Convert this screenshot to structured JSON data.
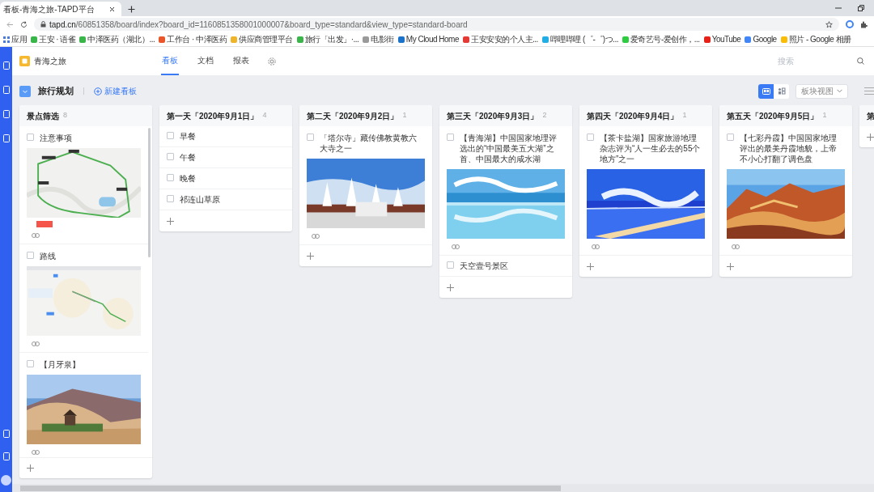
{
  "browser": {
    "tab_title": "看板-青海之旅-TAPD平台",
    "url_host": "tapd.cn",
    "url_path": "/60851358/board/index?board_id=1160851358001000007&board_type=standard&view_type=standard-board",
    "bookmarks": [
      {
        "label": "应用",
        "color": "#4a7bd8"
      },
      {
        "label": "王安 · 语雀",
        "color": "#39b54a"
      },
      {
        "label": "中泽医药（湖北）...",
        "color": "#39b54a"
      },
      {
        "label": "工作台 · 中泽医药",
        "color": "#e8562a"
      },
      {
        "label": "供应商管理平台",
        "color": "#f0b429"
      },
      {
        "label": "旅行「出发」·...",
        "color": "#39b54a"
      },
      {
        "label": "电影街",
        "color": "#9a9a9a"
      },
      {
        "label": "My Cloud Home",
        "color": "#1a73c8"
      },
      {
        "label": "王安安安的个人主...",
        "color": "#e53935"
      },
      {
        "label": "哔哩哔哩 (゜-゜)つ...",
        "color": "#23ade5"
      },
      {
        "label": "爱奇艺号-爱创作，...",
        "color": "#2ecc40"
      },
      {
        "label": "YouTube",
        "color": "#e62117"
      },
      {
        "label": "Google",
        "color": "#4285f4"
      },
      {
        "label": "照片 - Google 相册",
        "color": "#fbbc05"
      }
    ]
  },
  "app": {
    "project": "青海之旅",
    "nav_tabs": [
      {
        "label": "看板",
        "selected": true
      },
      {
        "label": "文档",
        "selected": false
      },
      {
        "label": "报表",
        "selected": false
      }
    ],
    "search": {
      "placeholder": "搜索"
    }
  },
  "toolbar": {
    "board_name": "旅行规划",
    "new_board": "新建看板",
    "view_toggle": [
      {
        "selected": true
      },
      {
        "selected": false
      }
    ],
    "view_dropdown": "板块视图"
  },
  "columns": [
    {
      "title": "景点筛选",
      "count": "8",
      "cards": [
        {
          "kind": "picture",
          "title": "注意事项",
          "checked": false,
          "label": {
            "color": "#f5544a"
          }
        },
        {
          "kind": "picture",
          "title": "路线",
          "checked": false
        },
        {
          "kind": "picture",
          "title": "【月牙泉】",
          "checked": false
        }
      ]
    },
    {
      "title": "第一天「2020年9月1日」",
      "count": "4",
      "cards": [
        {
          "kind": "task",
          "title": "早餐",
          "checked": false
        },
        {
          "kind": "task",
          "title": "午餐",
          "checked": false
        },
        {
          "kind": "task",
          "title": "晚餐",
          "checked": false
        },
        {
          "kind": "task",
          "title": "祁连山草原",
          "checked": false
        }
      ]
    },
    {
      "title": "第二天「2020年9月2日」",
      "count": "1",
      "cards": [
        {
          "kind": "picture",
          "title": "「塔尔寺」藏传佛教黄教六大寺之一",
          "checked": false
        }
      ]
    },
    {
      "title": "第三天「2020年9月3日」",
      "count": "2",
      "cards": [
        {
          "kind": "picture",
          "title": "【青海湖】中国国家地理评选出的“中国最美五大湖”之首、中国最大的咸水湖",
          "checked": false
        },
        {
          "kind": "task",
          "title": "天空壹号景区",
          "checked": false
        }
      ]
    },
    {
      "title": "第四天「2020年9月4日」",
      "count": "1",
      "cards": [
        {
          "kind": "picture",
          "title": "【茶卡盐湖】国家旅游地理杂志评为“人一生必去的55个地方”之一",
          "checked": false
        }
      ]
    },
    {
      "title": "第五天「2020年9月5日」",
      "count": "1",
      "cards": [
        {
          "kind": "picture",
          "title": "【七彩丹霞】中国国家地理评出的最美丹霞地貌，上帝不小心打翻了调色盘",
          "checked": false
        }
      ]
    },
    {
      "title": "第"
    }
  ]
}
